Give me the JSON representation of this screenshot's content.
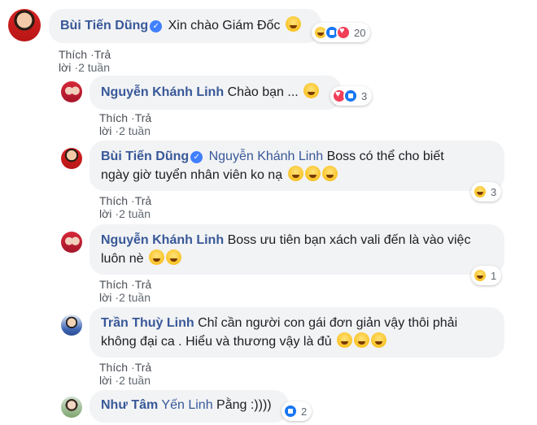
{
  "comments": [
    {
      "author": "Bùi Tiến Dũng",
      "verified": true,
      "text": "Xin chào Giám Đốc",
      "reaction_count": "20",
      "actions": {
        "like": "Thích",
        "reply": "Trả lời",
        "time": "2 tuần"
      }
    },
    {
      "author": "Nguyễn Khánh Linh",
      "text": "Chào bạn ...",
      "reaction_count": "3",
      "actions": {
        "like": "Thích",
        "reply": "Trả lời",
        "time": "2 tuần"
      }
    },
    {
      "author": "Bùi Tiến Dũng",
      "verified": true,
      "tag": "Nguyễn Khánh Linh",
      "text_line1": "Boss có thể cho biết",
      "text_line2": "ngày giờ tuyển nhân viên ko nạ",
      "reaction_count": "3",
      "actions": {
        "like": "Thích",
        "reply": "Trả lời",
        "time": "2 tuần"
      }
    },
    {
      "author": "Nguyễn Khánh Linh",
      "text_line1": "Boss ưu tiên bạn xách vali đến là vào việc",
      "text_line2": "luôn nè",
      "reaction_count": "1",
      "actions": {
        "like": "Thích",
        "reply": "Trả lời",
        "time": "2 tuần"
      }
    },
    {
      "author": "Trần Thuỳ Linh",
      "text_line1": "Chỉ cần người con gái đơn giản vậy thôi phải",
      "text_line2": "không đại ca . Hiểu và thương vậy là đủ",
      "actions": {
        "like": "Thích",
        "reply": "Trả lời",
        "time": "2 tuần"
      }
    },
    {
      "author": "Như Tâm",
      "tag": "Yến Linh",
      "text": "Pằng :))))",
      "reaction_count": "2"
    }
  ],
  "separator": "·",
  "verified_icon": "check-badge-icon"
}
